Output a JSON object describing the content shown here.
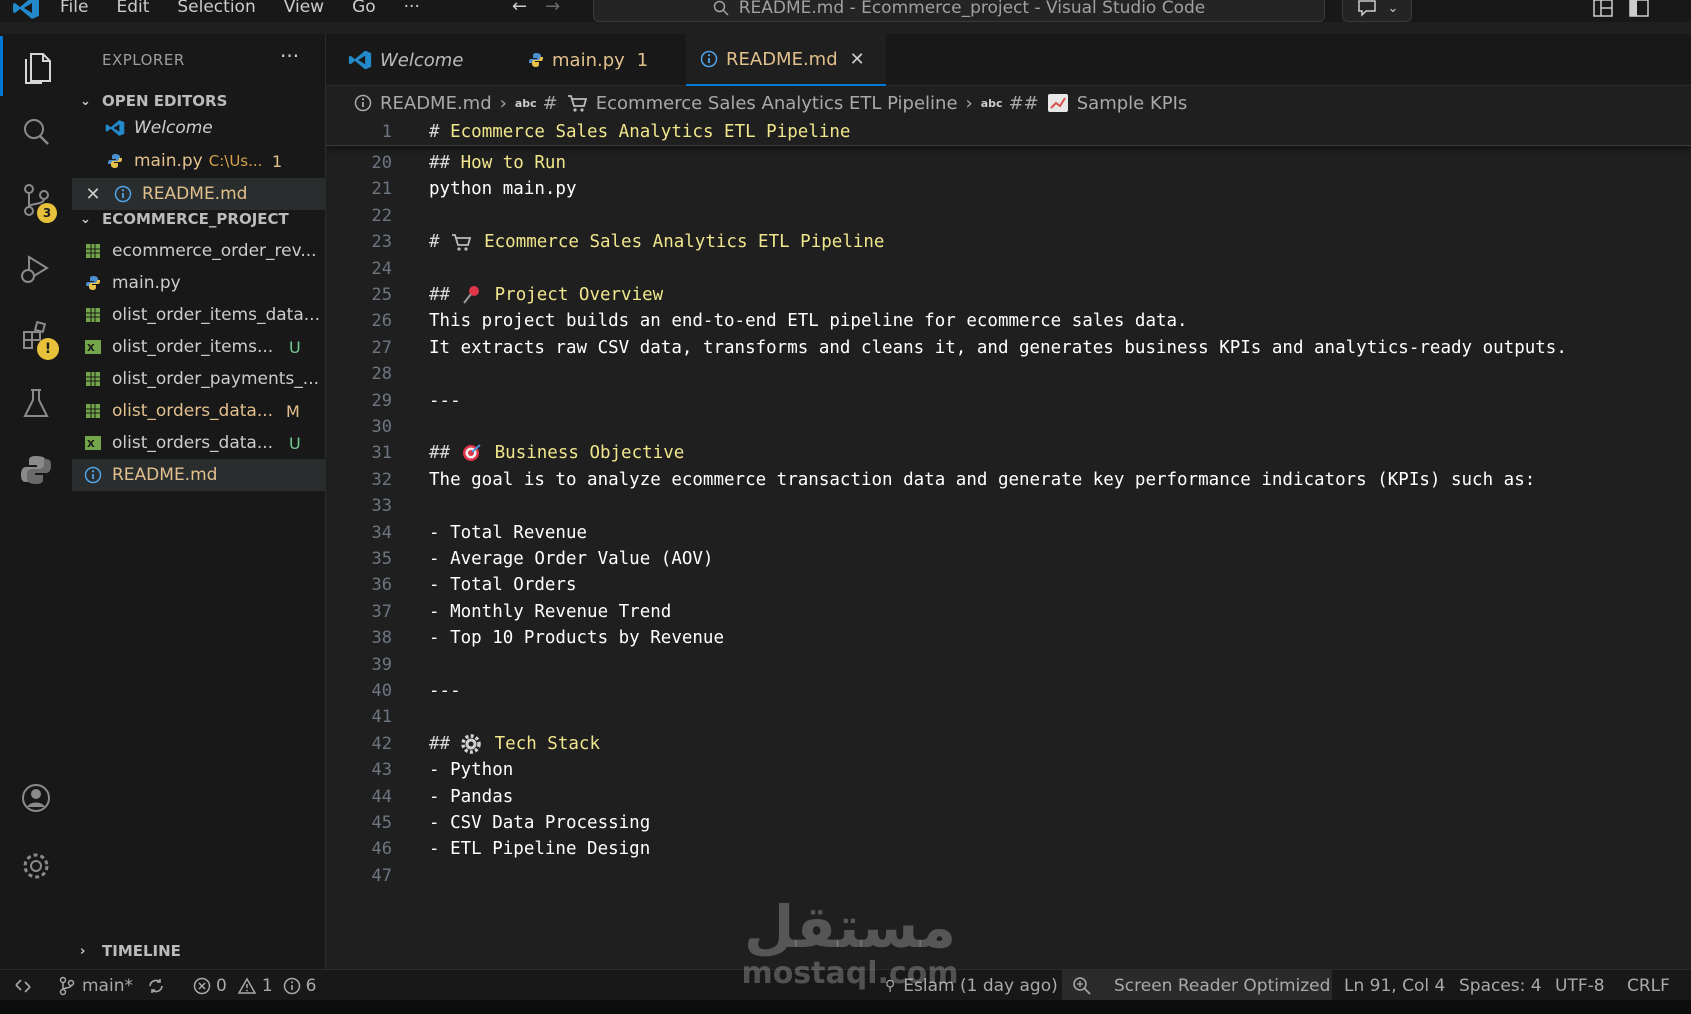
{
  "titlebar": {
    "menu": [
      "File",
      "Edit",
      "Selection",
      "View",
      "Go",
      "···"
    ],
    "search_text": "README.md - Ecommerce_project - Visual Studio Code"
  },
  "activitybar": {
    "source_control_badge": "3",
    "extensions_badge": "!"
  },
  "sidebar": {
    "title": "EXPLORER",
    "more": "···",
    "open_editors_label": "OPEN EDITORS",
    "open_editors": [
      {
        "name": "Welcome",
        "description": "",
        "status": ""
      },
      {
        "name": "main.py",
        "description": "C:\\Us...",
        "status": "1"
      },
      {
        "name": "README.md",
        "description": "",
        "status": ""
      }
    ],
    "project_label": "ECOMMERCE_PROJECT",
    "files": [
      {
        "name": "ecommerce_order_rev...",
        "status": ""
      },
      {
        "name": "main.py",
        "status": ""
      },
      {
        "name": "olist_order_items_data...",
        "status": ""
      },
      {
        "name": "olist_order_items...",
        "status": "U"
      },
      {
        "name": "olist_order_payments_...",
        "status": ""
      },
      {
        "name": "olist_orders_data...",
        "status": "M"
      },
      {
        "name": "olist_orders_data...",
        "status": "U"
      },
      {
        "name": "README.md",
        "status": ""
      }
    ],
    "timeline_label": "TIMELINE"
  },
  "tabs": [
    {
      "label": "Welcome",
      "count": ""
    },
    {
      "label": "main.py",
      "count": "1"
    },
    {
      "label": "README.md",
      "count": ""
    }
  ],
  "breadcrumb": {
    "file": "README.md",
    "h1_prefix": "#",
    "h1": "Ecommerce Sales Analytics ETL Pipeline",
    "h2_prefix": "##",
    "h2": "Sample KPIs",
    "abc": "abc"
  },
  "editor": {
    "sticky": {
      "num": "1",
      "hashes": "#",
      "text": "Ecommerce Sales Analytics ETL Pipeline"
    },
    "lines": [
      {
        "num": "20",
        "hashes": "##",
        "text": "How to Run",
        "emoji": "",
        "plain": ""
      },
      {
        "num": "21",
        "hashes": "",
        "text": "",
        "emoji": "",
        "plain": "python main.py"
      },
      {
        "num": "22",
        "hashes": "",
        "text": "",
        "emoji": "",
        "plain": ""
      },
      {
        "num": "23",
        "hashes": "#",
        "text": "Ecommerce Sales Analytics ETL Pipeline",
        "emoji": "cart-emoji",
        "plain": ""
      },
      {
        "num": "24",
        "hashes": "",
        "text": "",
        "emoji": "",
        "plain": ""
      },
      {
        "num": "25",
        "hashes": "##",
        "text": "Project Overview",
        "emoji": "pin-emoji",
        "plain": ""
      },
      {
        "num": "26",
        "hashes": "",
        "text": "",
        "emoji": "",
        "plain": "This project builds an end-to-end ETL pipeline for ecommerce sales data."
      },
      {
        "num": "27",
        "hashes": "",
        "text": "",
        "emoji": "",
        "plain": "It extracts raw CSV data, transforms and cleans it, and generates business KPIs and analytics-ready outputs."
      },
      {
        "num": "28",
        "hashes": "",
        "text": "",
        "emoji": "",
        "plain": ""
      },
      {
        "num": "29",
        "hashes": "",
        "text": "",
        "emoji": "",
        "plain": "---"
      },
      {
        "num": "30",
        "hashes": "",
        "text": "",
        "emoji": "",
        "plain": ""
      },
      {
        "num": "31",
        "hashes": "##",
        "text": "Business Objective",
        "emoji": "target-emoji",
        "plain": ""
      },
      {
        "num": "32",
        "hashes": "",
        "text": "",
        "emoji": "",
        "plain": "The goal is to analyze ecommerce transaction data and generate key performance indicators (KPIs) such as:"
      },
      {
        "num": "33",
        "hashes": "",
        "text": "",
        "emoji": "",
        "plain": ""
      },
      {
        "num": "34",
        "hashes": "",
        "text": "",
        "emoji": "",
        "plain": "- Total Revenue"
      },
      {
        "num": "35",
        "hashes": "",
        "text": "",
        "emoji": "",
        "plain": "- Average Order Value (AOV)"
      },
      {
        "num": "36",
        "hashes": "",
        "text": "",
        "emoji": "",
        "plain": "- Total Orders"
      },
      {
        "num": "37",
        "hashes": "",
        "text": "",
        "emoji": "",
        "plain": "- Monthly Revenue Trend"
      },
      {
        "num": "38",
        "hashes": "",
        "text": "",
        "emoji": "",
        "plain": "- Top 10 Products by Revenue"
      },
      {
        "num": "39",
        "hashes": "",
        "text": "",
        "emoji": "",
        "plain": ""
      },
      {
        "num": "40",
        "hashes": "",
        "text": "",
        "emoji": "",
        "plain": "---"
      },
      {
        "num": "41",
        "hashes": "",
        "text": "",
        "emoji": "",
        "plain": ""
      },
      {
        "num": "42",
        "hashes": "##",
        "text": "Tech Stack",
        "emoji": "gear-emoji",
        "plain": ""
      },
      {
        "num": "43",
        "hashes": "",
        "text": "",
        "emoji": "",
        "plain": "- Python"
      },
      {
        "num": "44",
        "hashes": "",
        "text": "",
        "emoji": "",
        "plain": "- Pandas"
      },
      {
        "num": "45",
        "hashes": "",
        "text": "",
        "emoji": "",
        "plain": "- CSV Data Processing"
      },
      {
        "num": "46",
        "hashes": "",
        "text": "",
        "emoji": "",
        "plain": "- ETL Pipeline Design"
      },
      {
        "num": "47",
        "hashes": "",
        "text": "",
        "emoji": "",
        "plain": ""
      }
    ]
  },
  "statusbar": {
    "branch": "main*",
    "errors": "0",
    "warnings": "1",
    "infos": "6",
    "blame": "Eslam (1 day ago)",
    "screen_reader": "Screen Reader Optimized",
    "cursor": "Ln 91, Col 4",
    "spaces": "Spaces: 4",
    "encoding": "UTF-8",
    "eol": "CRLF"
  },
  "watermark": {
    "arabic": "مستقل",
    "latin": "mostaql.com"
  },
  "colors": {
    "accent": "#0078d4",
    "heading": "#f0e68c",
    "modified": "#e2c08d",
    "untracked": "#73c991"
  }
}
